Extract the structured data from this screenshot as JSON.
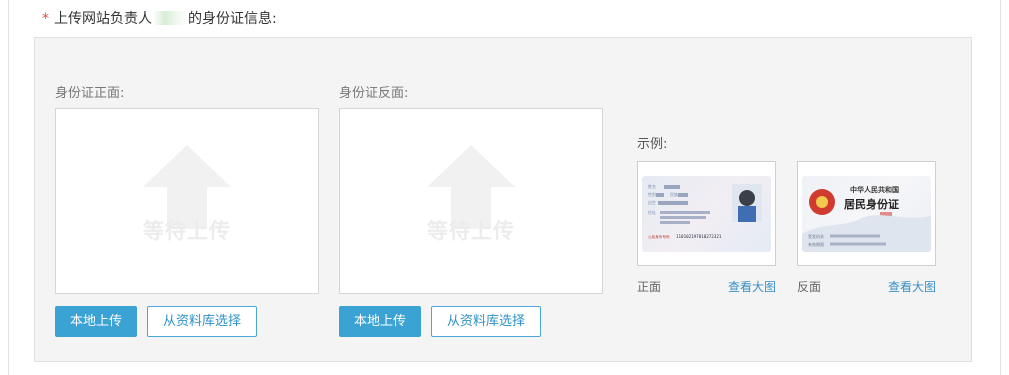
{
  "title": {
    "required_mark": "*",
    "prefix": "上传网站负责人",
    "suffix": "的身份证信息:"
  },
  "front": {
    "label": "身份证正面:",
    "placeholder": "等待上传",
    "upload_button": "本地上传",
    "library_button": "从资料库选择"
  },
  "back": {
    "label": "身份证反面:",
    "placeholder": "等待上传",
    "upload_button": "本地上传",
    "library_button": "从资料库选择"
  },
  "example": {
    "label": "示例:",
    "front_caption": "正面",
    "back_caption": "反面",
    "view_large": "查看大图",
    "front_card": {
      "name": "姓名",
      "gender": "性别",
      "ethnicity": "民族",
      "birth": "出生",
      "address": "住址",
      "id_label": "公民身份号码",
      "id_number": "110102197810272321"
    },
    "back_card": {
      "country": "中华人民共和国",
      "title": "居民身份证",
      "authority": "签发机关",
      "validity": "有效期限"
    }
  },
  "colors": {
    "primary": "#3ba2d4",
    "required": "#e84c3d",
    "panel_bg": "#f4f4f4"
  }
}
